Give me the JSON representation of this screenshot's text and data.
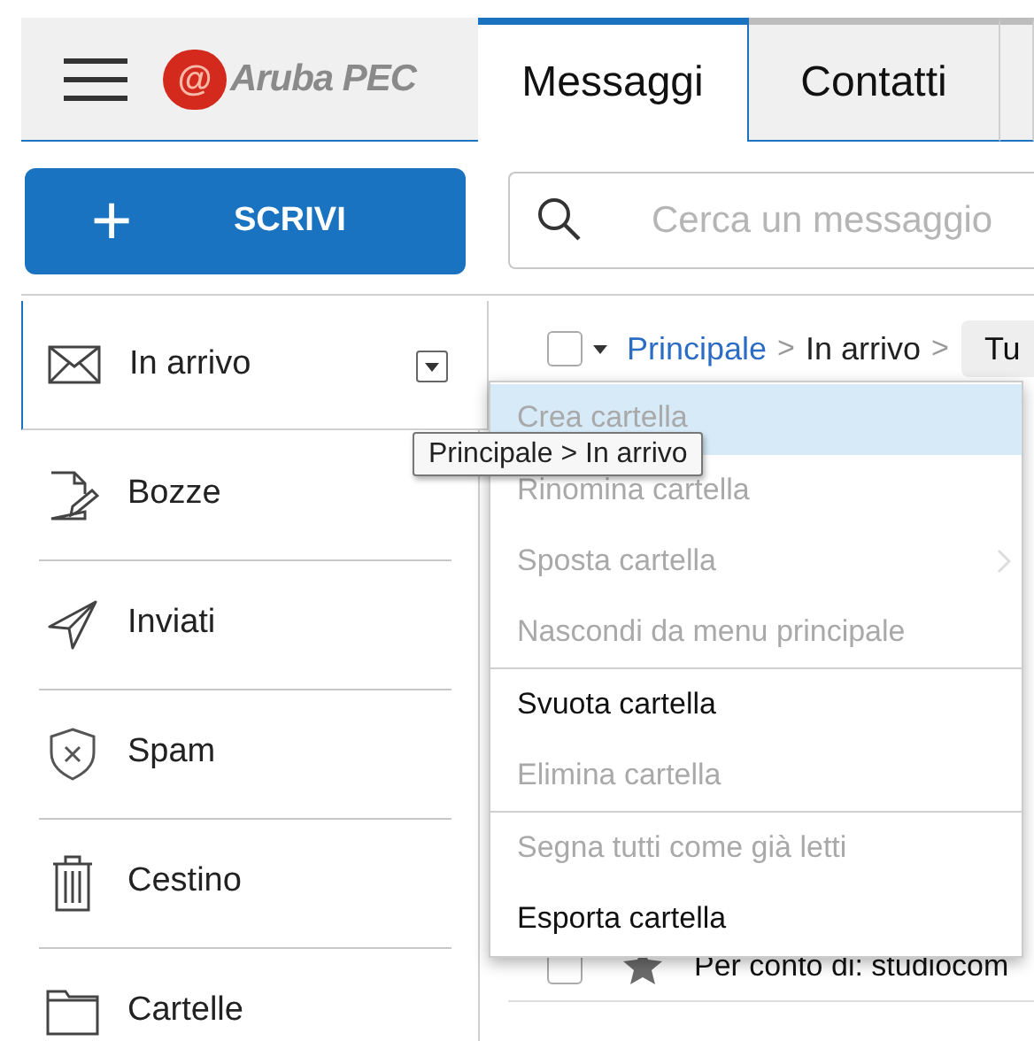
{
  "header": {
    "logo": {
      "symbol": "@",
      "text": "Aruba PEC"
    }
  },
  "tabs": [
    {
      "label": "Messaggi",
      "selected": true
    },
    {
      "label": "Contatti",
      "selected": false
    },
    {
      "selected": false
    }
  ],
  "compose_button": {
    "icon": "+",
    "label": "SCRIVI"
  },
  "search": {
    "placeholder": "Cerca un messaggio"
  },
  "folders": [
    {
      "label": "In arrivo",
      "selected": true
    },
    {
      "label": "Bozze",
      "selected": false
    },
    {
      "label": "Inviati",
      "selected": false
    },
    {
      "label": "Spam",
      "selected": false
    },
    {
      "label": "Cestino",
      "selected": false
    },
    {
      "label": "Cartelle",
      "selected": false
    }
  ],
  "toolbar": {
    "checked": false,
    "breadcrumb": [
      "Principale",
      "In arrivo"
    ],
    "separator": ">",
    "filter_button": "Tu"
  },
  "messages": [
    {
      "checked": false,
      "text": "Per conto di: studiocom",
      "starred": false
    }
  ],
  "context_menu": {
    "items": [
      {
        "label": "Crea cartella",
        "disabled": true,
        "highlighted": true
      },
      {
        "label": "Rinomina cartella",
        "disabled": true,
        "highlighted": false
      },
      {
        "label": "Sposta cartella",
        "disabled": true,
        "highlighted": false,
        "submenu": true
      },
      {
        "label": "Nascondi da menu principale",
        "disabled": true,
        "highlighted": false,
        "divider_after": true
      },
      {
        "label": "Svuota cartella",
        "disabled": false,
        "highlighted": false
      },
      {
        "label": "Elimina cartella",
        "disabled": true,
        "highlighted": false,
        "divider_after": true
      },
      {
        "label": "Segna tutti come già letti",
        "disabled": true,
        "highlighted": false
      },
      {
        "label": "Esporta cartella",
        "disabled": false,
        "highlighted": false
      }
    ]
  },
  "tooltip": "Principale > In arrivo"
}
